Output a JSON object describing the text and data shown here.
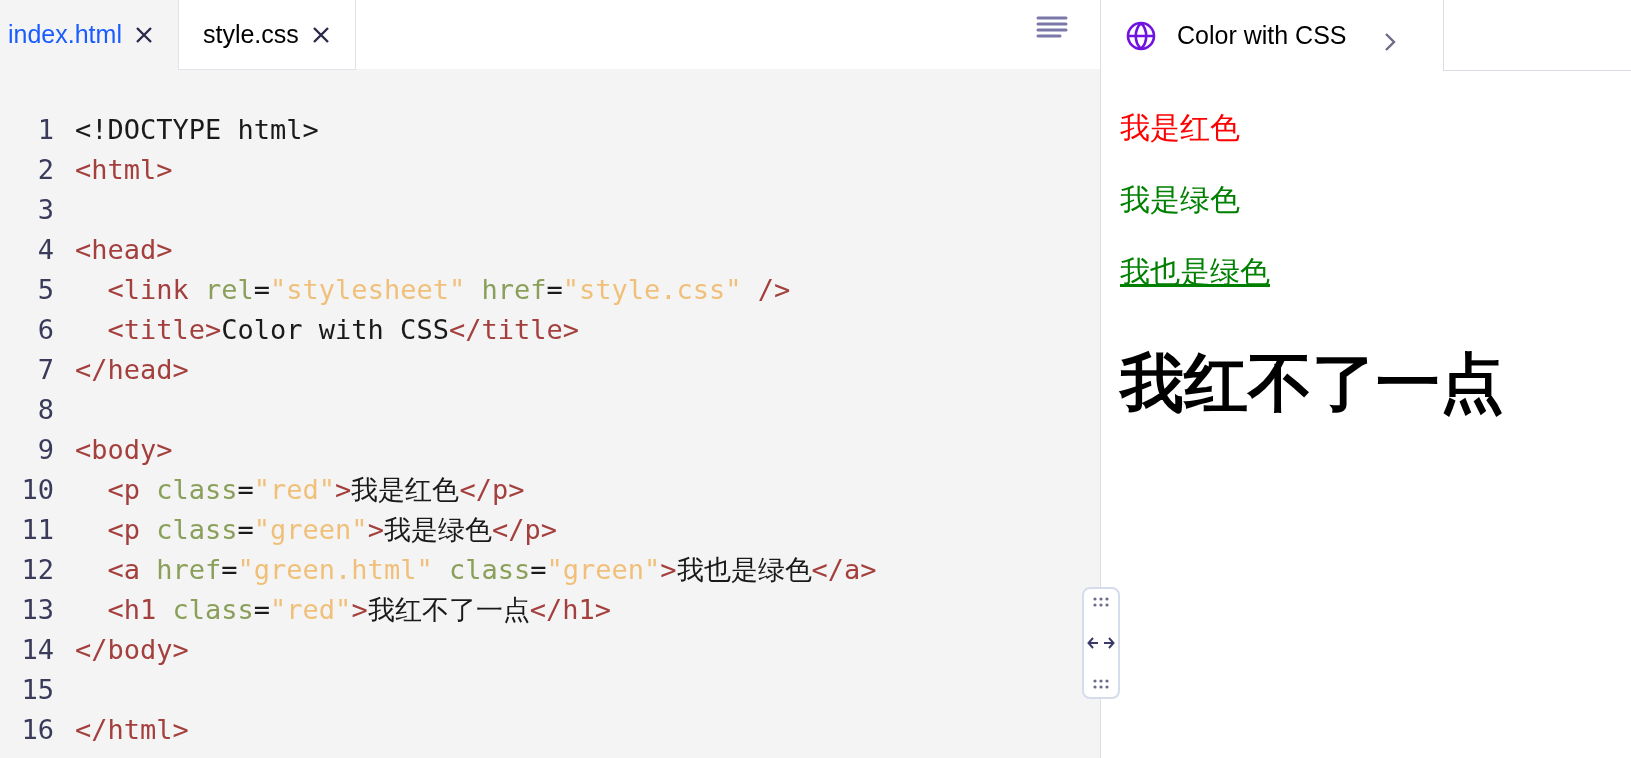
{
  "editor": {
    "tabs": [
      {
        "label": "index.html",
        "selected": true
      },
      {
        "label": "style.css",
        "selected": false
      }
    ],
    "lines": [
      {
        "number": "1",
        "tokens": [
          {
            "kind": "text",
            "text": "<!DOCTYPE html>"
          }
        ]
      },
      {
        "number": "2",
        "tokens": [
          {
            "kind": "tag",
            "text": "<html>"
          }
        ]
      },
      {
        "number": "3"
      },
      {
        "number": "4",
        "tokens": [
          {
            "kind": "tag",
            "text": "<head>"
          }
        ]
      },
      {
        "number": "5",
        "tokens": [
          {
            "kind": "tag",
            "text": "  <link "
          },
          {
            "kind": "attr",
            "text": "rel"
          },
          {
            "kind": "text",
            "text": "="
          },
          {
            "kind": "string",
            "text": "\"stylesheet\" "
          },
          {
            "kind": "attr",
            "text": "href"
          },
          {
            "kind": "text",
            "text": "="
          },
          {
            "kind": "string",
            "text": "\"style.css\" "
          },
          {
            "kind": "tag",
            "text": "/>"
          }
        ]
      },
      {
        "number": "6",
        "tokens": [
          {
            "kind": "tag",
            "text": "  <title>"
          },
          {
            "kind": "text",
            "text": "Color with CSS"
          },
          {
            "kind": "tag",
            "text": "</title>"
          }
        ]
      },
      {
        "number": "7",
        "tokens": [
          {
            "kind": "tag",
            "text": "</head>"
          }
        ]
      },
      {
        "number": "8"
      },
      {
        "number": "9",
        "tokens": [
          {
            "kind": "tag",
            "text": "<body>"
          }
        ]
      },
      {
        "number": "10",
        "tokens": [
          {
            "kind": "tag",
            "text": "  <p "
          },
          {
            "kind": "attr",
            "text": "class"
          },
          {
            "kind": "text",
            "text": "="
          },
          {
            "kind": "string",
            "text": "\"red\""
          },
          {
            "kind": "tag",
            "text": ">"
          },
          {
            "kind": "text",
            "text": "我是红色"
          },
          {
            "kind": "tag",
            "text": "</p>"
          }
        ]
      },
      {
        "number": "11",
        "tokens": [
          {
            "kind": "tag",
            "text": "  <p "
          },
          {
            "kind": "attr",
            "text": "class"
          },
          {
            "kind": "text",
            "text": "="
          },
          {
            "kind": "string",
            "text": "\"green\""
          },
          {
            "kind": "tag",
            "text": ">"
          },
          {
            "kind": "text",
            "text": "我是绿色"
          },
          {
            "kind": "tag",
            "text": "</p>"
          }
        ]
      },
      {
        "number": "12",
        "tokens": [
          {
            "kind": "tag",
            "text": "  <a "
          },
          {
            "kind": "attr",
            "text": "href"
          },
          {
            "kind": "text",
            "text": "="
          },
          {
            "kind": "string",
            "text": "\"green.html\" "
          },
          {
            "kind": "attr",
            "text": "class"
          },
          {
            "kind": "text",
            "text": "="
          },
          {
            "kind": "string",
            "text": "\"green\""
          },
          {
            "kind": "tag",
            "text": ">"
          },
          {
            "kind": "text",
            "text": "我也是绿色"
          },
          {
            "kind": "tag",
            "text": "</a>"
          }
        ]
      },
      {
        "number": "13",
        "tokens": [
          {
            "kind": "tag",
            "text": "  <h1 "
          },
          {
            "kind": "attr",
            "text": "class"
          },
          {
            "kind": "text",
            "text": "="
          },
          {
            "kind": "string",
            "text": "\"red\""
          },
          {
            "kind": "tag",
            "text": ">"
          },
          {
            "kind": "text",
            "text": "我红不了一点"
          },
          {
            "kind": "tag",
            "text": "</h1>"
          }
        ]
      },
      {
        "number": "14",
        "tokens": [
          {
            "kind": "tag",
            "text": "</body>"
          }
        ]
      },
      {
        "number": "15"
      },
      {
        "number": "16",
        "tokens": [
          {
            "kind": "tag",
            "text": "</html>"
          }
        ]
      }
    ]
  },
  "preview": {
    "tab": {
      "title": "Color with CSS"
    },
    "elements": [
      {
        "kind": "paragraph",
        "text": "我是红色",
        "color": "#ff0000"
      },
      {
        "kind": "paragraph",
        "text": "我是绿色",
        "color": "#008000"
      },
      {
        "kind": "link",
        "text": "我也是绿色",
        "color": "#008000"
      },
      {
        "kind": "heading",
        "text": "我红不了一点",
        "color": "#000000"
      }
    ]
  }
}
